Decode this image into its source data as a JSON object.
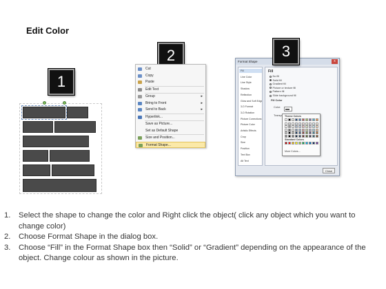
{
  "title": "Edit Color",
  "badges": [
    "1",
    "2",
    "3"
  ],
  "context_menu": {
    "items": [
      {
        "label": "Cut",
        "icon": "scissors-icon",
        "submenu": false
      },
      {
        "label": "Copy",
        "icon": "copy-icon",
        "submenu": false
      },
      {
        "label": "Paste",
        "icon": "paste-icon",
        "submenu": false
      },
      {
        "label": "Edit Text",
        "icon": "edit-text-icon",
        "submenu": false
      },
      {
        "label": "Group",
        "icon": "group-icon",
        "submenu": true
      },
      {
        "label": "Bring to Front",
        "icon": "bring-front-icon",
        "submenu": true
      },
      {
        "label": "Send to Back",
        "icon": "send-back-icon",
        "submenu": true
      },
      {
        "label": "Hyperlink...",
        "icon": "hyperlink-icon",
        "submenu": false
      },
      {
        "label": "Save as Picture...",
        "icon": "",
        "submenu": false
      },
      {
        "label": "Set as Default Shape",
        "icon": "",
        "submenu": false
      },
      {
        "label": "Size and Position...",
        "icon": "size-position-icon",
        "submenu": false
      },
      {
        "label": "Format Shape...",
        "icon": "format-shape-icon",
        "submenu": false
      }
    ],
    "highlighted_index": 11
  },
  "format_dialog": {
    "title": "Format Shape",
    "close_label": "x",
    "nav_items": [
      "Fill",
      "Line Color",
      "Line Style",
      "Shadow",
      "Reflection",
      "Glow and Soft Edges",
      "3-D Format",
      "3-D Rotation",
      "Picture Corrections",
      "Picture Color",
      "Artistic Effects",
      "Crop",
      "Size",
      "Position",
      "Text Box",
      "Alt Text"
    ],
    "active_nav_index": 0,
    "pane_heading": "Fill",
    "fill_options": [
      "No fill",
      "Solid fill",
      "Gradient fill",
      "Picture or texture fill",
      "Pattern fill",
      "Slide background fill"
    ],
    "selected_fill_index": 1,
    "fill_color_label": "Fill Color",
    "color_label": "Color:",
    "transparency_label": "Transpar",
    "close_button": "Close"
  },
  "palette": {
    "theme_label": "Theme Colors",
    "standard_label": "Standard Colors",
    "more_label": "More Colors...",
    "theme_colors": [
      "#ffffff",
      "#000000",
      "#eeece1",
      "#1f497d",
      "#4f81bd",
      "#c0504d",
      "#9bbb59",
      "#8064a2",
      "#4bacc6",
      "#f79646"
    ],
    "standard_colors": [
      "#c00000",
      "#ff0000",
      "#ffc000",
      "#ffff00",
      "#92d050",
      "#00b050",
      "#00b0f0",
      "#0070c0",
      "#002060",
      "#7030a0"
    ]
  },
  "steps": [
    {
      "num": "1.",
      "text": "Select the shape to change the color and Right click the object( click any object which you want to change color)"
    },
    {
      "num": "2.",
      "text": "Choose Format Shape in the dialog box."
    },
    {
      "num": "3.",
      "text": "Choose “Fill” in the Format Shape box then “Solid” or “Gradient” depending on the appearance of the object. Change colour as shown in the picture."
    }
  ]
}
